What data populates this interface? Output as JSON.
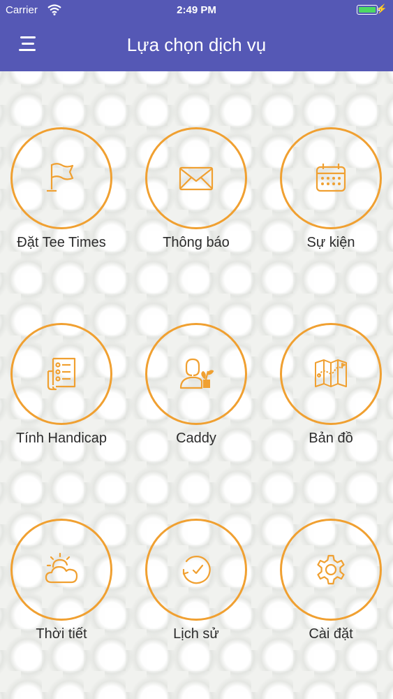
{
  "status_bar": {
    "carrier": "Carrier",
    "time": "2:49 PM"
  },
  "header": {
    "title": "Lựa chọn dịch vụ",
    "menu_icon": "hamburger-menu-icon"
  },
  "colors": {
    "header": "#5558b5",
    "accent": "#f0a031",
    "battery": "#4cd964"
  },
  "services": [
    {
      "label": "Đặt Tee Times",
      "icon": "flag-icon"
    },
    {
      "label": "Thông báo",
      "icon": "envelope-icon"
    },
    {
      "label": "Sự kiện",
      "icon": "calendar-icon"
    },
    {
      "label": "Tính Handicap",
      "icon": "scorecard-icon"
    },
    {
      "label": "Caddy",
      "icon": "caddy-person-icon"
    },
    {
      "label": "Bản đồ",
      "icon": "map-icon"
    },
    {
      "label": "Thời tiết",
      "icon": "weather-icon"
    },
    {
      "label": "Lịch sử",
      "icon": "history-icon"
    },
    {
      "label": "Cài đặt",
      "icon": "gear-icon"
    }
  ]
}
